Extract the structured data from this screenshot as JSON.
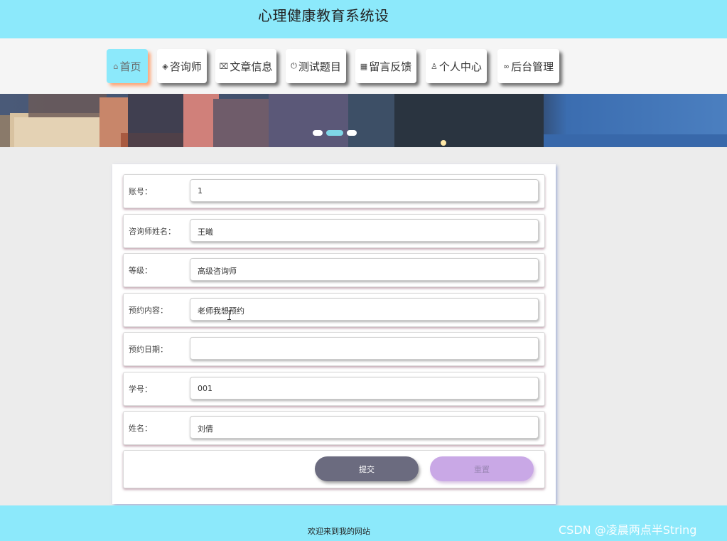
{
  "header": {
    "title": "心理健康教育系统设"
  },
  "nav": {
    "items": [
      {
        "icon": "⌂",
        "icon_name": "home-icon",
        "label": "首页",
        "active": true
      },
      {
        "icon": "◈",
        "icon_name": "layers-icon",
        "label": "咨询师"
      },
      {
        "icon": "⌧",
        "icon_name": "book-icon",
        "label": "文章信息"
      },
      {
        "icon": "⏻",
        "icon_name": "power-icon",
        "label": "测试题目"
      },
      {
        "icon": "▦",
        "icon_name": "grid-icon",
        "label": "留言反馈"
      },
      {
        "icon": "♙",
        "icon_name": "user-icon",
        "label": "个人中心"
      },
      {
        "icon": "∞",
        "icon_name": "link-icon",
        "label": "后台管理"
      }
    ]
  },
  "banner": {
    "active_slide": 2,
    "slide_count": 3
  },
  "form": {
    "fields": [
      {
        "label": "账号：",
        "value": "1"
      },
      {
        "label": "咨询师姓名：",
        "value": "王曦"
      },
      {
        "label": "等级：",
        "value": "高级咨询师"
      },
      {
        "label": "预约内容：",
        "value": "老师我想预约"
      },
      {
        "label": "预约日期：",
        "value": ""
      },
      {
        "label": "学号：",
        "value": "001"
      },
      {
        "label": "姓名：",
        "value": "刘倩"
      }
    ],
    "submit_label": "提交",
    "reset_label": "重置"
  },
  "footer": {
    "text": "欢迎来到我的网站",
    "watermark": "CSDN @凌晨两点半String"
  },
  "colors": {
    "header_bg": "#8ce9fb",
    "submit_bg": "#6b6b7f",
    "reset_bg": "#c9a8e6"
  }
}
